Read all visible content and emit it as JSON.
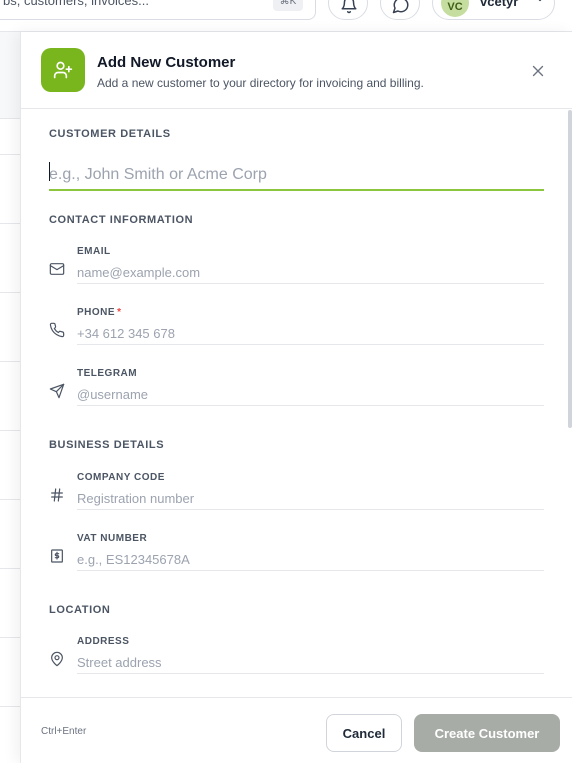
{
  "background": {
    "search_placeholder": "bs, customers, invoices...",
    "search_shortcut": "⌘K",
    "user_initials": "VC",
    "user_name": "vcetyr"
  },
  "drawer": {
    "title": "Add New Customer",
    "subtitle": "Add a new customer to your directory for invoicing and billing.",
    "sections": {
      "customer_details": "CUSTOMER DETAILS",
      "contact_information": "CONTACT INFORMATION",
      "business_details": "BUSINESS DETAILS",
      "location": "LOCATION"
    },
    "name_field": {
      "placeholder": "e.g., John Smith or Acme Corp",
      "value": ""
    },
    "fields": {
      "email": {
        "label": "EMAIL",
        "placeholder": "name@example.com",
        "icon": "mail-icon"
      },
      "phone": {
        "label": "PHONE",
        "required_mark": "*",
        "placeholder": "+34 612 345 678",
        "icon": "phone-icon"
      },
      "telegram": {
        "label": "TELEGRAM",
        "placeholder": "@username",
        "icon": "send-icon"
      },
      "company_code": {
        "label": "COMPANY CODE",
        "placeholder": "Registration number",
        "icon": "hash-icon"
      },
      "vat_number": {
        "label": "VAT NUMBER",
        "placeholder": "e.g., ES12345678A",
        "icon": "receipt-icon"
      },
      "address": {
        "label": "ADDRESS",
        "placeholder": "Street address",
        "icon": "map-pin-icon"
      }
    },
    "footer": {
      "hint": "Ctrl+Enter",
      "cancel_label": "Cancel",
      "create_label": "Create Customer"
    }
  },
  "colors": {
    "accent": "#79b51d",
    "focus_underline": "#8cc63f",
    "required": "#ef4444",
    "disabled_button": "#a7aca6"
  }
}
